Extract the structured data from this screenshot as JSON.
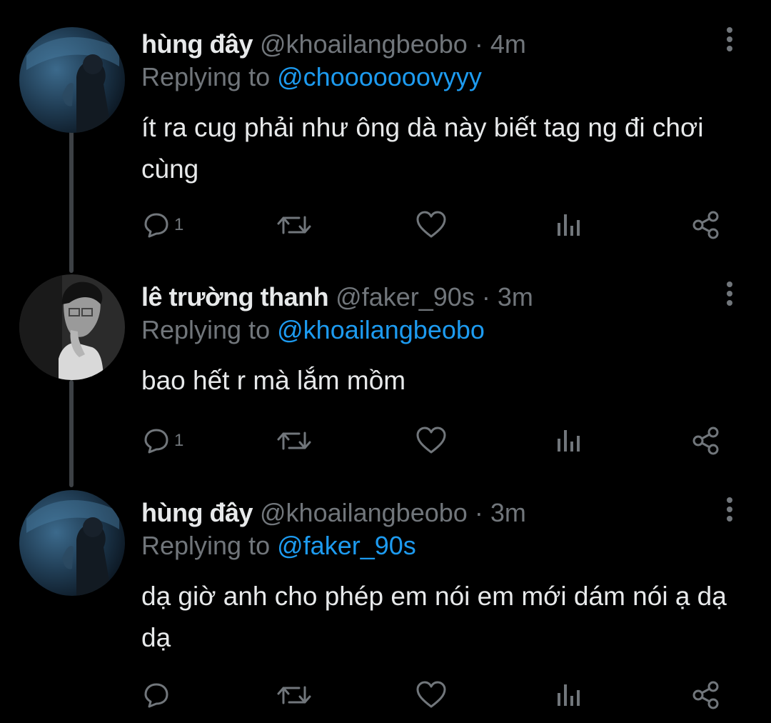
{
  "colors": {
    "background": "#000000",
    "text_primary": "#e7e9ea",
    "text_secondary": "#71767b",
    "accent": "#1d9bf0",
    "thread_line": "#3d4145"
  },
  "tweets": [
    {
      "name": "hùng đây",
      "handle": "@khoailangbeobo",
      "separator": "·",
      "time": "4m",
      "replying_prefix": "Replying to",
      "replying_to": "@chooooooovyyy",
      "text": "ít ra cug phải như ông dà này biết tag ng đi chơi cùng",
      "reply_count": "1",
      "avatar": "dark-blue-aquarium-avatar"
    },
    {
      "name": "lê trường thanh",
      "handle": "@faker_90s",
      "separator": "·",
      "time": "3m",
      "replying_prefix": "Replying to",
      "replying_to": "@khoailangbeobo",
      "text": "bao hết r mà lắm mồm",
      "reply_count": "1",
      "avatar": "grayscale-portrait-avatar"
    },
    {
      "name": "hùng đây",
      "handle": "@khoailangbeobo",
      "separator": "·",
      "time": "3m",
      "replying_prefix": "Replying to",
      "replying_to": "@faker_90s",
      "text": "dạ giờ anh cho phép em nói em mới dám nói ạ dạ dạ",
      "reply_count": "",
      "avatar": "dark-blue-aquarium-avatar"
    }
  ],
  "icons": {
    "reply": "speech-bubble-icon",
    "retweet": "retweet-arrows-icon",
    "like": "heart-icon",
    "views": "bar-chart-icon",
    "share": "share-nodes-icon",
    "more": "vertical-ellipsis-icon"
  }
}
